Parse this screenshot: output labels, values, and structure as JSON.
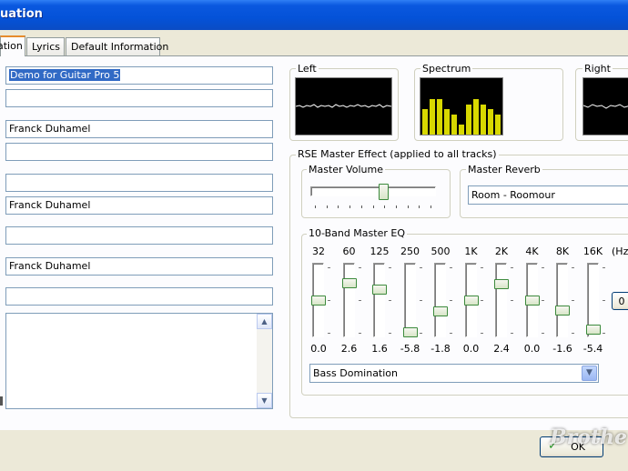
{
  "window": {
    "title": "uation"
  },
  "tabs": [
    {
      "label": "ation"
    },
    {
      "label": "Lyrics"
    },
    {
      "label": "Default Information"
    }
  ],
  "fields": [
    {
      "value": "Demo for Guitar Pro 5"
    },
    {
      "value": ""
    },
    {
      "value": "Franck Duhamel"
    },
    {
      "value": ""
    },
    {
      "value": ""
    },
    {
      "value": "Franck Duhamel"
    },
    {
      "value": ""
    },
    {
      "value": "Franck Duhamel"
    },
    {
      "value": ""
    }
  ],
  "scopes": {
    "left_label": "Left",
    "spectrum_label": "Spectrum",
    "right_label": "Right",
    "spectrum_bars": [
      0.45,
      0.63,
      0.63,
      0.45,
      0.36,
      0.18,
      0.54,
      0.63,
      0.54,
      0.45,
      0.36
    ]
  },
  "rse": {
    "label": "RSE Master Effect (applied to all tracks)",
    "master_volume_label": "Master Volume",
    "master_volume_level": 0.59,
    "master_reverb_label": "Master Reverb",
    "master_reverb_value": "Room - Roomour"
  },
  "eq": {
    "label": "10-Band Master EQ",
    "unit_label": "(Hz",
    "reset_label": "0",
    "bands": [
      {
        "freq": "32",
        "value": "0.0",
        "level": 0.5
      },
      {
        "freq": "60",
        "value": "2.6",
        "level": 0.76
      },
      {
        "freq": "125",
        "value": "1.6",
        "level": 0.66
      },
      {
        "freq": "250",
        "value": "-5.8",
        "level": 0.0
      },
      {
        "freq": "500",
        "value": "-1.8",
        "level": 0.32
      },
      {
        "freq": "1K",
        "value": "0.0",
        "level": 0.5
      },
      {
        "freq": "2K",
        "value": "2.4",
        "level": 0.74
      },
      {
        "freq": "4K",
        "value": "0.0",
        "level": 0.5
      },
      {
        "freq": "8K",
        "value": "-1.6",
        "level": 0.34
      },
      {
        "freq": "16K",
        "value": "-5.4",
        "level": 0.04
      }
    ],
    "preset": "Bass Domination"
  },
  "buttons": {
    "ok_label": "OK"
  },
  "watermark": "Brothe",
  "colors": {
    "titlebar": "#0452d8",
    "selection": "#316ac5",
    "spectrum_bar": "#d8d800",
    "waveform": "#ffffff",
    "thumb_border": "#3c8a3c"
  }
}
